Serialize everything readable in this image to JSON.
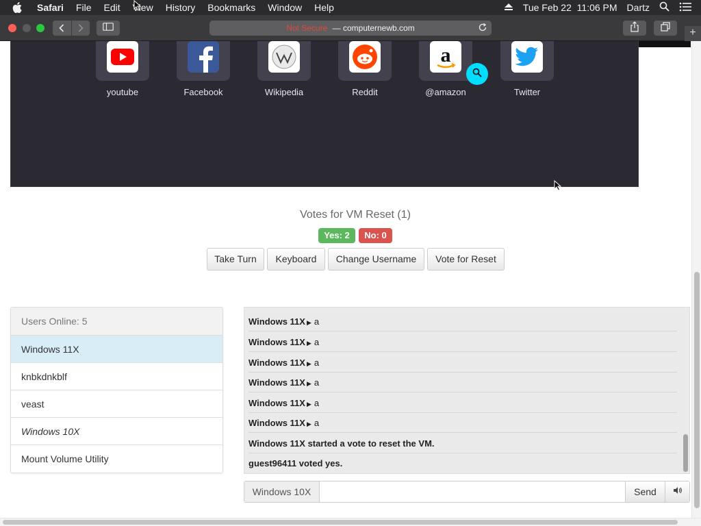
{
  "menubar": {
    "app_name": "Safari",
    "items": [
      "File",
      "Edit",
      "View",
      "History",
      "Bookmarks",
      "Window",
      "Help"
    ],
    "datetime": "Tue Feb 22  11:06 PM",
    "user": "Dartz",
    "icons": [
      "apple-icon",
      "eject-icon",
      "spotlight-search-icon",
      "control-center-list-icon"
    ]
  },
  "browser": {
    "url_security": "Not Secure",
    "url_separator": " — ",
    "url_domain": "computernewb.com",
    "newtab_glyph": "+"
  },
  "vm_screen": {
    "shortcuts": [
      {
        "label": "youtube",
        "icon": "youtube-icon",
        "color": "#ff0000"
      },
      {
        "label": "Facebook",
        "icon": "facebook-icon",
        "color": "#3b5998"
      },
      {
        "label": "Wikipedia",
        "icon": "wikipedia-icon",
        "color": "#ffffff"
      },
      {
        "label": "Reddit",
        "icon": "reddit-icon",
        "color": "#ff4500"
      },
      {
        "label": "@amazon",
        "icon": "amazon-icon",
        "color": "#ff9900"
      },
      {
        "label": "Twitter",
        "icon": "twitter-icon",
        "color": "#1da1f2"
      }
    ],
    "background_color": "#2b2a33"
  },
  "votes": {
    "title": "Votes for VM Reset (1)",
    "yes_label": "Yes: 2",
    "no_label": "No: 0"
  },
  "actions": {
    "take_turn": "Take Turn",
    "keyboard": "Keyboard",
    "change_username": "Change Username",
    "vote_reset": "Vote for Reset"
  },
  "users": {
    "header": "Users Online: 5",
    "list": [
      {
        "name": "Windows 11X",
        "active": true,
        "italic": false
      },
      {
        "name": "knbkdnkblf",
        "active": false,
        "italic": false
      },
      {
        "name": "veast",
        "active": false,
        "italic": false
      },
      {
        "name": "Windows 10X",
        "active": false,
        "italic": true
      },
      {
        "name": "Mount Volume Utility",
        "active": false,
        "italic": false
      }
    ]
  },
  "chat": {
    "messages": [
      {
        "user": "Windows 11X",
        "text": "a"
      },
      {
        "user": "Windows 11X",
        "text": "a"
      },
      {
        "user": "Windows 11X",
        "text": "a"
      },
      {
        "user": "Windows 11X",
        "text": "a"
      },
      {
        "user": "Windows 11X",
        "text": "a"
      },
      {
        "user": "Windows 11X",
        "text": "a"
      }
    ],
    "system_messages": [
      "Windows 11X started a vote to reset the VM.",
      "guest96411 voted yes."
    ],
    "username_addon": "Windows 10X",
    "input_value": "",
    "send_label": "Send"
  },
  "colors": {
    "accent_yes": "#5cb85c",
    "accent_no": "#d9534f",
    "active_user": "#d9edf7",
    "menubar": "#2b2b2d",
    "toolbar": "#3a3a3c"
  }
}
